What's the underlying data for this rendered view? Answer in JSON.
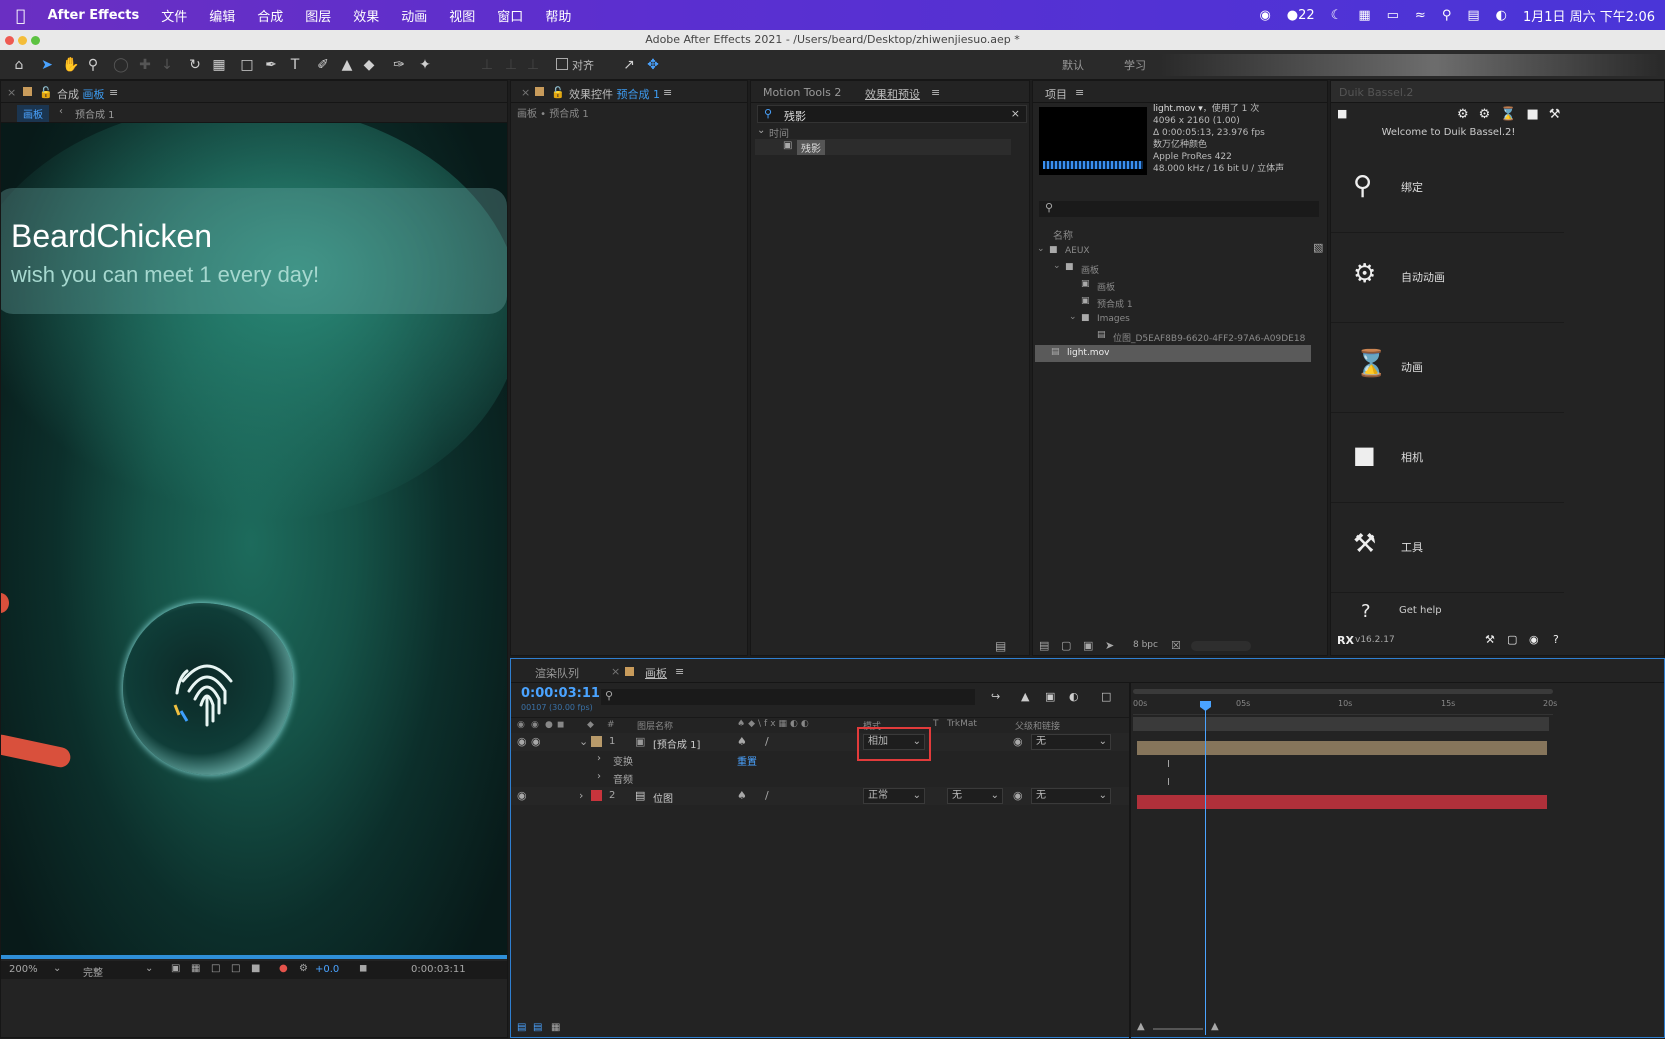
{
  "menubar": {
    "apple_icon": "apple-icon",
    "app": "After Effects",
    "items": [
      "文件",
      "编辑",
      "合成",
      "图层",
      "效果",
      "动画",
      "视图",
      "窗口",
      "帮助"
    ],
    "notif_count": "22",
    "datetime": "1月1日 周六 下午2:06"
  },
  "window": {
    "title": "Adobe After Effects 2021 - /Users/beard/Desktop/zhiwenjiesuo.aep *"
  },
  "toolbar": {
    "align_label": "对齐",
    "workspace_default": "默认",
    "workspace_learn": "学习"
  },
  "comp_panel": {
    "tab_prefix": "合成",
    "tab_name": "画板",
    "crumb_active": "画板",
    "crumb_prev": "预合成 1",
    "title": "BeardChicken",
    "subtitle": "wish you can meet 1 every day!",
    "zoom": "200%",
    "quality": "完整",
    "exposure": "+0.0",
    "timecode": "0:00:03:11"
  },
  "effect_controls": {
    "tab_label": "效果控件",
    "tab_layer": "预合成 1",
    "crumb": "画板 • 预合成 1"
  },
  "effects_presets": {
    "tab_motion": "Motion Tools 2",
    "tab_label": "效果和预设",
    "search_value": "残影",
    "group": "时间",
    "item": "残影"
  },
  "project": {
    "tab_label": "项目",
    "footage_name": "light.mov ▾",
    "footage_used": "，使用了 1 次",
    "footage_res": "4096 x 2160 (1.00)",
    "footage_dur": "Δ 0:00:05:13, 23.976 fps",
    "footage_colors": "数万亿种颜色",
    "footage_codec": "Apple ProRes 422",
    "footage_audio": "48.000 kHz / 16 bit U / 立体声",
    "col_name": "名称",
    "tree": [
      {
        "label": "AEUX",
        "type": "folder",
        "indent": 0
      },
      {
        "label": "画板",
        "type": "folder",
        "indent": 1
      },
      {
        "label": "画板",
        "type": "comp",
        "indent": 2
      },
      {
        "label": "预合成 1",
        "type": "comp",
        "indent": 2
      },
      {
        "label": "Images",
        "type": "folder",
        "indent": 2
      },
      {
        "label": "位图_D5EAF8B9-6620-4FF2-97A6-A09DE181",
        "type": "file",
        "indent": 3
      },
      {
        "label": "light.mov",
        "type": "file",
        "indent": 0,
        "selected": true
      }
    ],
    "bpc": "8 bpc"
  },
  "duik": {
    "tab_label": "Duik Bassel.2",
    "welcome": "Welcome to Duik Bassel.2!",
    "buttons": [
      "绑定",
      "自动动画",
      "动画",
      "相机",
      "工具"
    ],
    "help": "Get help",
    "version": "v16.2.17"
  },
  "timeline": {
    "tab_render": "渲染队列",
    "tab_comp": "画板",
    "timecode": "0:00:03:11",
    "frame_info": "00107 (30.00 fps)",
    "headers": {
      "num": "#",
      "name": "图层名称",
      "mode": "模式",
      "t": "T",
      "trkmat": "TrkMat",
      "parent": "父级和链接"
    },
    "layers": [
      {
        "num": "1",
        "name": "[预合成 1]",
        "mode": "相加",
        "trkmat": "",
        "parent": "无",
        "color": "#b89a6a"
      },
      {
        "num": "2",
        "name": "位图",
        "mode": "正常",
        "trkmat": "无",
        "parent": "无",
        "color": "#c8343c"
      }
    ],
    "sub_transform": "变换",
    "sub_reset": "重置",
    "sub_audio": "音频",
    "ruler": [
      "00s",
      "05s",
      "10s",
      "15s",
      "20s"
    ],
    "playhead_fraction": 0.175
  }
}
